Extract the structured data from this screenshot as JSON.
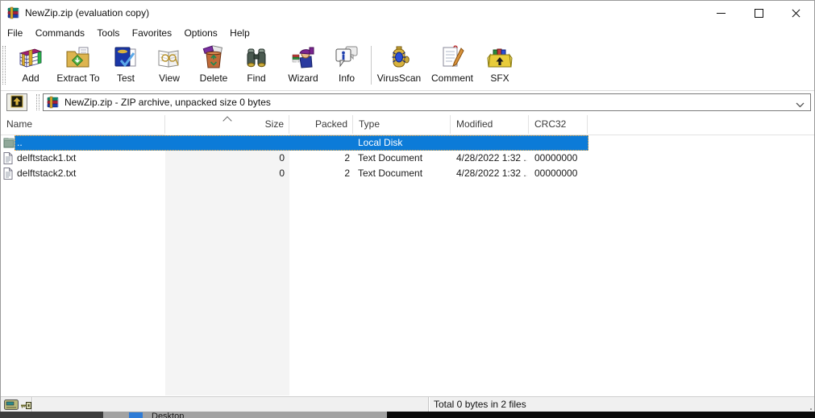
{
  "window": {
    "title": "NewZip.zip (evaluation copy)"
  },
  "menu": {
    "items": [
      "File",
      "Commands",
      "Tools",
      "Favorites",
      "Options",
      "Help"
    ]
  },
  "toolbar": {
    "buttons": [
      "Add",
      "Extract To",
      "Test",
      "View",
      "Delete",
      "Find",
      "Wizard",
      "Info",
      "VirusScan",
      "Comment",
      "SFX"
    ]
  },
  "addressbar": {
    "archive_label": "NewZip.zip - ZIP archive, unpacked size 0 bytes"
  },
  "list": {
    "columns": [
      "Name",
      "Size",
      "Packed",
      "Type",
      "Modified",
      "CRC32"
    ],
    "sort": {
      "column": "Size",
      "direction": "ascending"
    },
    "rows": [
      {
        "name": "..",
        "size": "",
        "packed": "",
        "type": "Local Disk",
        "modified": "",
        "crc32": "",
        "selected": true
      },
      {
        "name": "delftstack1.txt",
        "size": "0",
        "packed": "2",
        "type": "Text Document",
        "modified": "4/28/2022 1:32 ...",
        "crc32": "00000000",
        "selected": false
      },
      {
        "name": "delftstack2.txt",
        "size": "0",
        "packed": "2",
        "type": "Text Document",
        "modified": "4/28/2022 1:32 ...",
        "crc32": "00000000",
        "selected": false
      }
    ]
  },
  "statusbar": {
    "total": "Total 0 bytes in 2 files"
  },
  "background_window": {
    "fragment_label": "Desktop"
  },
  "icons": {
    "app": "winrar-archive-books",
    "toolbar": [
      "archive-books",
      "extract-folder",
      "test-book-check",
      "view-open-book",
      "delete-trash",
      "find-binoculars",
      "wizard-figure",
      "info-bubble",
      "virusscan-bottle-bug",
      "comment-page-pencil",
      "sfx-box-arrow"
    ],
    "up_one_level": "folder-up-arrow",
    "combo_archive": "zip-archive-books",
    "combo_dropdown": "chevron-down",
    "sort_indicator": "caret-up",
    "parent_row": "folder",
    "file_row": "text-document",
    "status_left": [
      "drive",
      "key"
    ],
    "resize_grip": "grip-dots"
  },
  "colors": {
    "selection": "#0c7bd8",
    "selection_focus_dots": "#e8a33d",
    "size_column_band": "#f4f4f4",
    "statusbar_bg": "#f0f0f0",
    "window_bg": "#ffffff"
  }
}
